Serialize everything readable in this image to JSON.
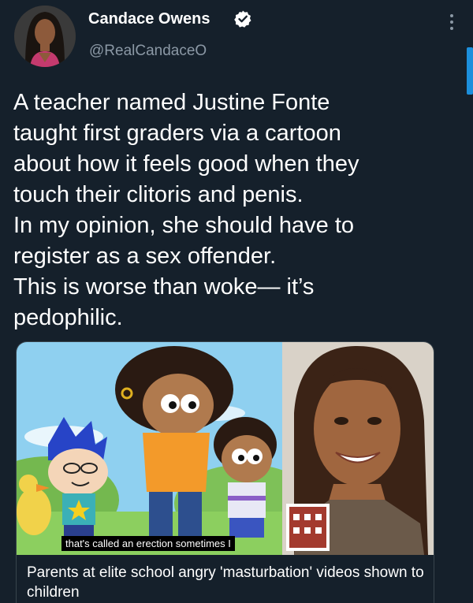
{
  "author": {
    "name": "Candace Owens",
    "handle": "@RealCandaceO",
    "verified": true
  },
  "icons": {
    "verified": "verified-badge-icon",
    "more": "more-vertical-icon"
  },
  "tweet": {
    "lines": [
      "A teacher named Justine Fonte",
      "taught first graders via a cartoon",
      "about how it feels good when they",
      "touch their clitoris and penis.",
      "In my opinion, she should have to",
      "register as a sex offender.",
      "This is worse than woke— it’s",
      "pedophilic."
    ]
  },
  "card": {
    "caption": "that's called an erection sometimes I",
    "title": "Parents at elite school angry 'masturbation' videos shown to children"
  },
  "colors": {
    "background": "#15202b",
    "text": "#ffffff",
    "secondary": "#8b98a5",
    "accent": "#1d9bf0",
    "border": "#38444d"
  }
}
